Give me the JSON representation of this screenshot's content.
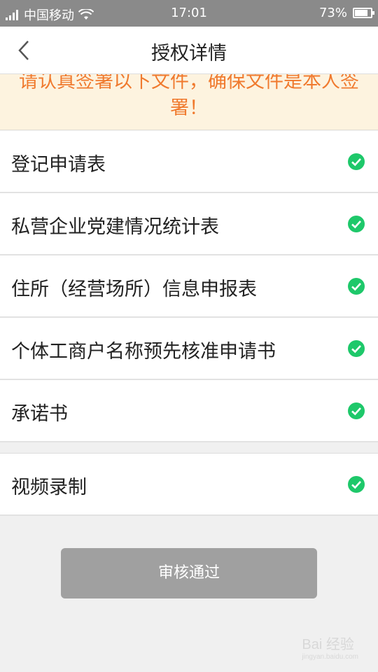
{
  "status_bar": {
    "carrier": "中国移动",
    "time": "17:01",
    "battery_text": "73%",
    "battery_level": 0.73
  },
  "nav": {
    "title": "授权详情",
    "back_icon": "chevron-left-icon"
  },
  "notice": {
    "text": "请认真签署以下文件，确保文件是本人签署！",
    "color": "#f07a2e",
    "background": "#fdf3df"
  },
  "documents": [
    {
      "label": "登记申请表",
      "status_icon": "check-circle-icon"
    },
    {
      "label": "私营企业党建情况统计表",
      "status_icon": "check-circle-icon"
    },
    {
      "label": "住所（经营场所）信息申报表",
      "status_icon": "check-circle-icon"
    },
    {
      "label": "个体工商户名称预先核准申请书",
      "status_icon": "check-circle-icon"
    },
    {
      "label": "承诺书",
      "status_icon": "check-circle-icon"
    }
  ],
  "video": {
    "label": "视频录制",
    "status_icon": "check-circle-icon"
  },
  "approve_button": {
    "label": "审核通过",
    "color": "#a0a0a0"
  },
  "watermark": {
    "text": "Bai 经验",
    "sub": "jingyan.baidu.com"
  },
  "colors": {
    "check_green": "#1ec86a"
  }
}
